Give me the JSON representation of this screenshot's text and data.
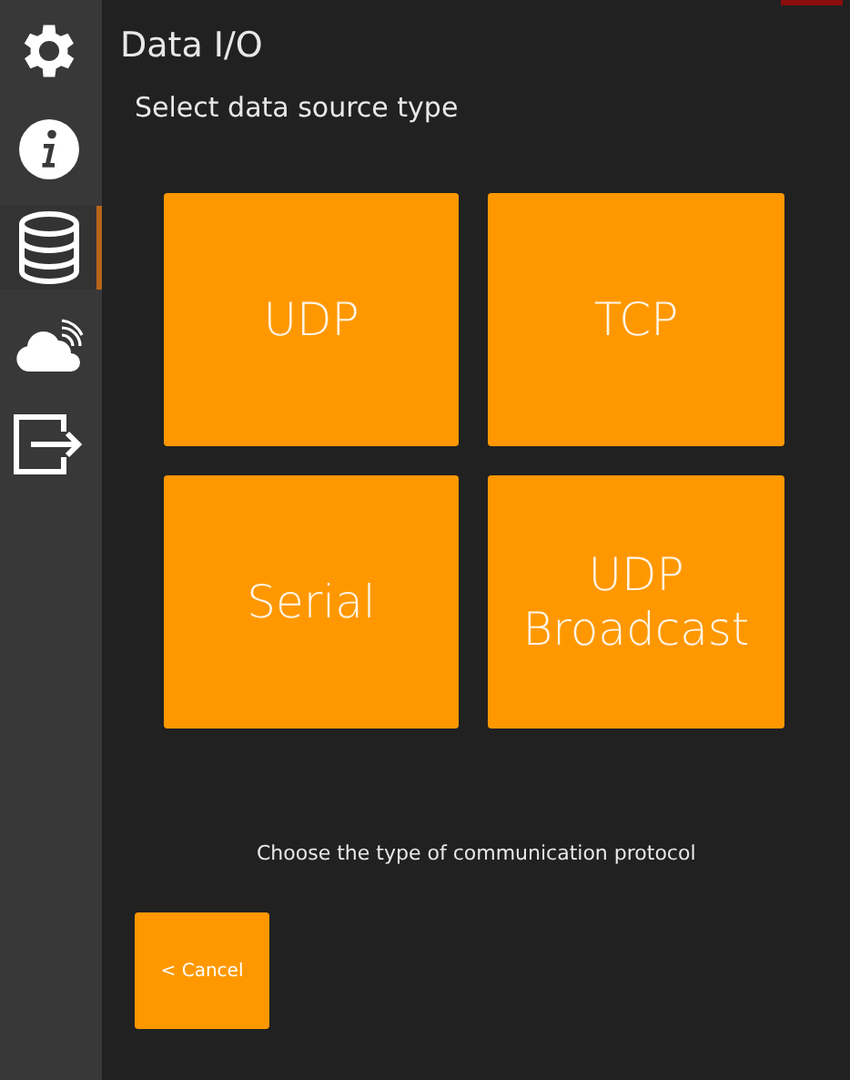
{
  "sidebar": {
    "items": [
      {
        "kind": "gear",
        "selected": false
      },
      {
        "kind": "info",
        "selected": false
      },
      {
        "kind": "database",
        "selected": true
      },
      {
        "kind": "cloud",
        "selected": false
      },
      {
        "kind": "exit",
        "selected": false
      }
    ]
  },
  "title": "Data I/O",
  "subtitle": "Select data source type",
  "options": [
    {
      "label": "UDP"
    },
    {
      "label": "TCP"
    },
    {
      "label": "Serial"
    },
    {
      "label": "UDP Broadcast"
    }
  ],
  "hint": "Choose the type of communication protocol",
  "cancel_button": "< Cancel"
}
